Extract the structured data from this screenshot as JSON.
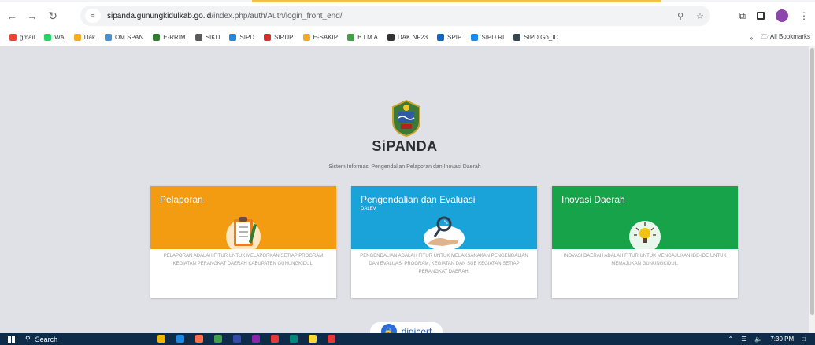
{
  "browser": {
    "url_host": "sipanda.gunungkidulkab.go.id",
    "url_path": "/index.php/auth/Auth/login_front_end/",
    "bookmarks": [
      {
        "label": "gmail",
        "color": "#ea4335"
      },
      {
        "label": "WA",
        "color": "#25d366"
      },
      {
        "label": "Dak",
        "color": "#f2b01e"
      },
      {
        "label": "OM SPAN",
        "color": "#4a90d9"
      },
      {
        "label": "E-RRIM",
        "color": "#2e7d32"
      },
      {
        "label": "SIKD",
        "color": "#5a5a5a"
      },
      {
        "label": "SIPD",
        "color": "#1e88e5"
      },
      {
        "label": "SIRUP",
        "color": "#d32f2f"
      },
      {
        "label": "E-SAKIP",
        "color": "#f9a825"
      },
      {
        "label": "B I M A",
        "color": "#43a047"
      },
      {
        "label": "DAK NF23",
        "color": "#333333"
      },
      {
        "label": "SPIP",
        "color": "#1565c0"
      },
      {
        "label": "SIPD RI",
        "color": "#1e88e5"
      },
      {
        "label": "SIPD Go_ID",
        "color": "#37474f"
      }
    ],
    "more_bookmarks": "»",
    "all_bookmarks": "All Bookmarks"
  },
  "page": {
    "brand": "SiPANDA",
    "tagline": "Sistem Informasi Pengendalian Pelaporan dan Inovasi Daerah",
    "cards": [
      {
        "title": "Pelaporan",
        "subtitle": "",
        "color": "#f39c12",
        "icon": "clipboard-checklist-icon",
        "description": "PELAPORAN ADALAH FITUR UNTUK MELAPORKAN SETIAP PROGRAM KEGIATAN PERANGKAT DAERAH KABUPATEN GUNUNGKIDUL."
      },
      {
        "title": "Pengendalian dan Evaluasi",
        "subtitle": "DALEV",
        "color": "#1aa3d8",
        "icon": "magnifier-hand-icon",
        "description": "PENGENDALIAN ADALAH FITUR UNTUK MELAKSANAKAN PENGENDALIAN DAN EVALUASI PROGRAM, KEGIATAN DAN SUB KEGIATAN SETIAP PERANGKAT DAERAH."
      },
      {
        "title": "Inovasi Daerah",
        "subtitle": "",
        "color": "#17a34a",
        "icon": "idea-lightbulb-icon",
        "description": "INOVASI DAERAH ADALAH FITUR UNTUK MENGAJUKAN IDE-IDE UNTUK MEMAJUKAN GUNUNGKIDUL."
      }
    ],
    "seal": "digicert"
  },
  "taskbar": {
    "search_label": "Search",
    "time": "7:30 PM"
  }
}
